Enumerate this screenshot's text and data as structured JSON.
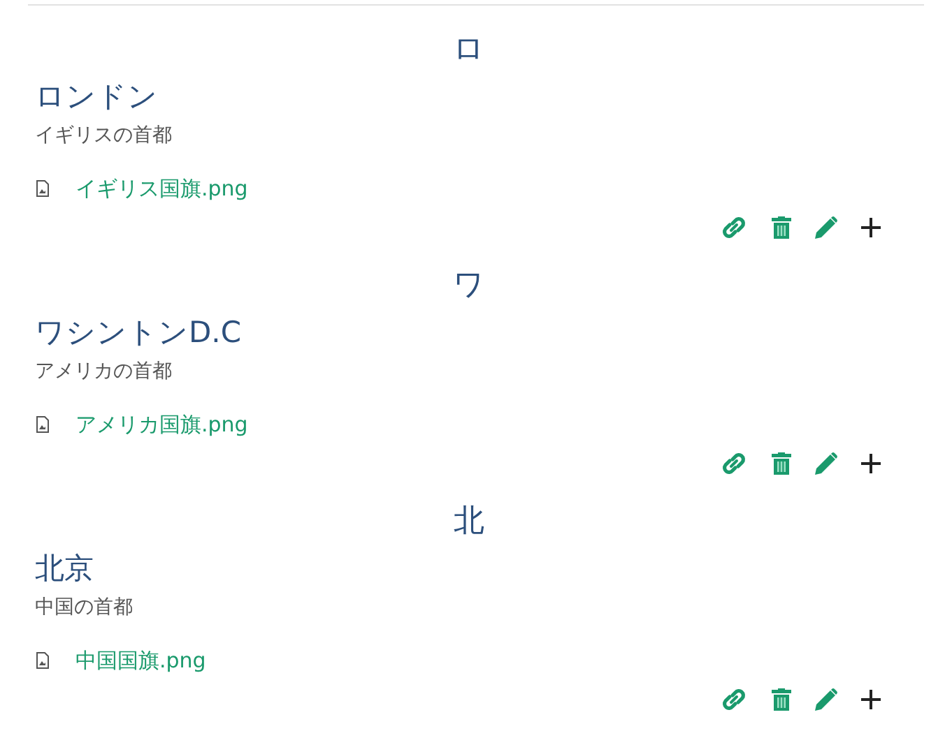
{
  "sections": [
    {
      "heading": "ロ",
      "entries": [
        {
          "title": "ロンドン",
          "description": "イギリスの首都",
          "files": [
            "イギリス国旗.png"
          ]
        }
      ]
    },
    {
      "heading": "ワ",
      "entries": [
        {
          "title": "ワシントンD.C",
          "description": "アメリカの首都",
          "files": [
            "アメリカ国旗.png"
          ]
        }
      ]
    },
    {
      "heading": "北",
      "entries": [
        {
          "title": "北京",
          "description": "中国の首都",
          "files": [
            "中国国旗.png"
          ]
        }
      ]
    }
  ]
}
